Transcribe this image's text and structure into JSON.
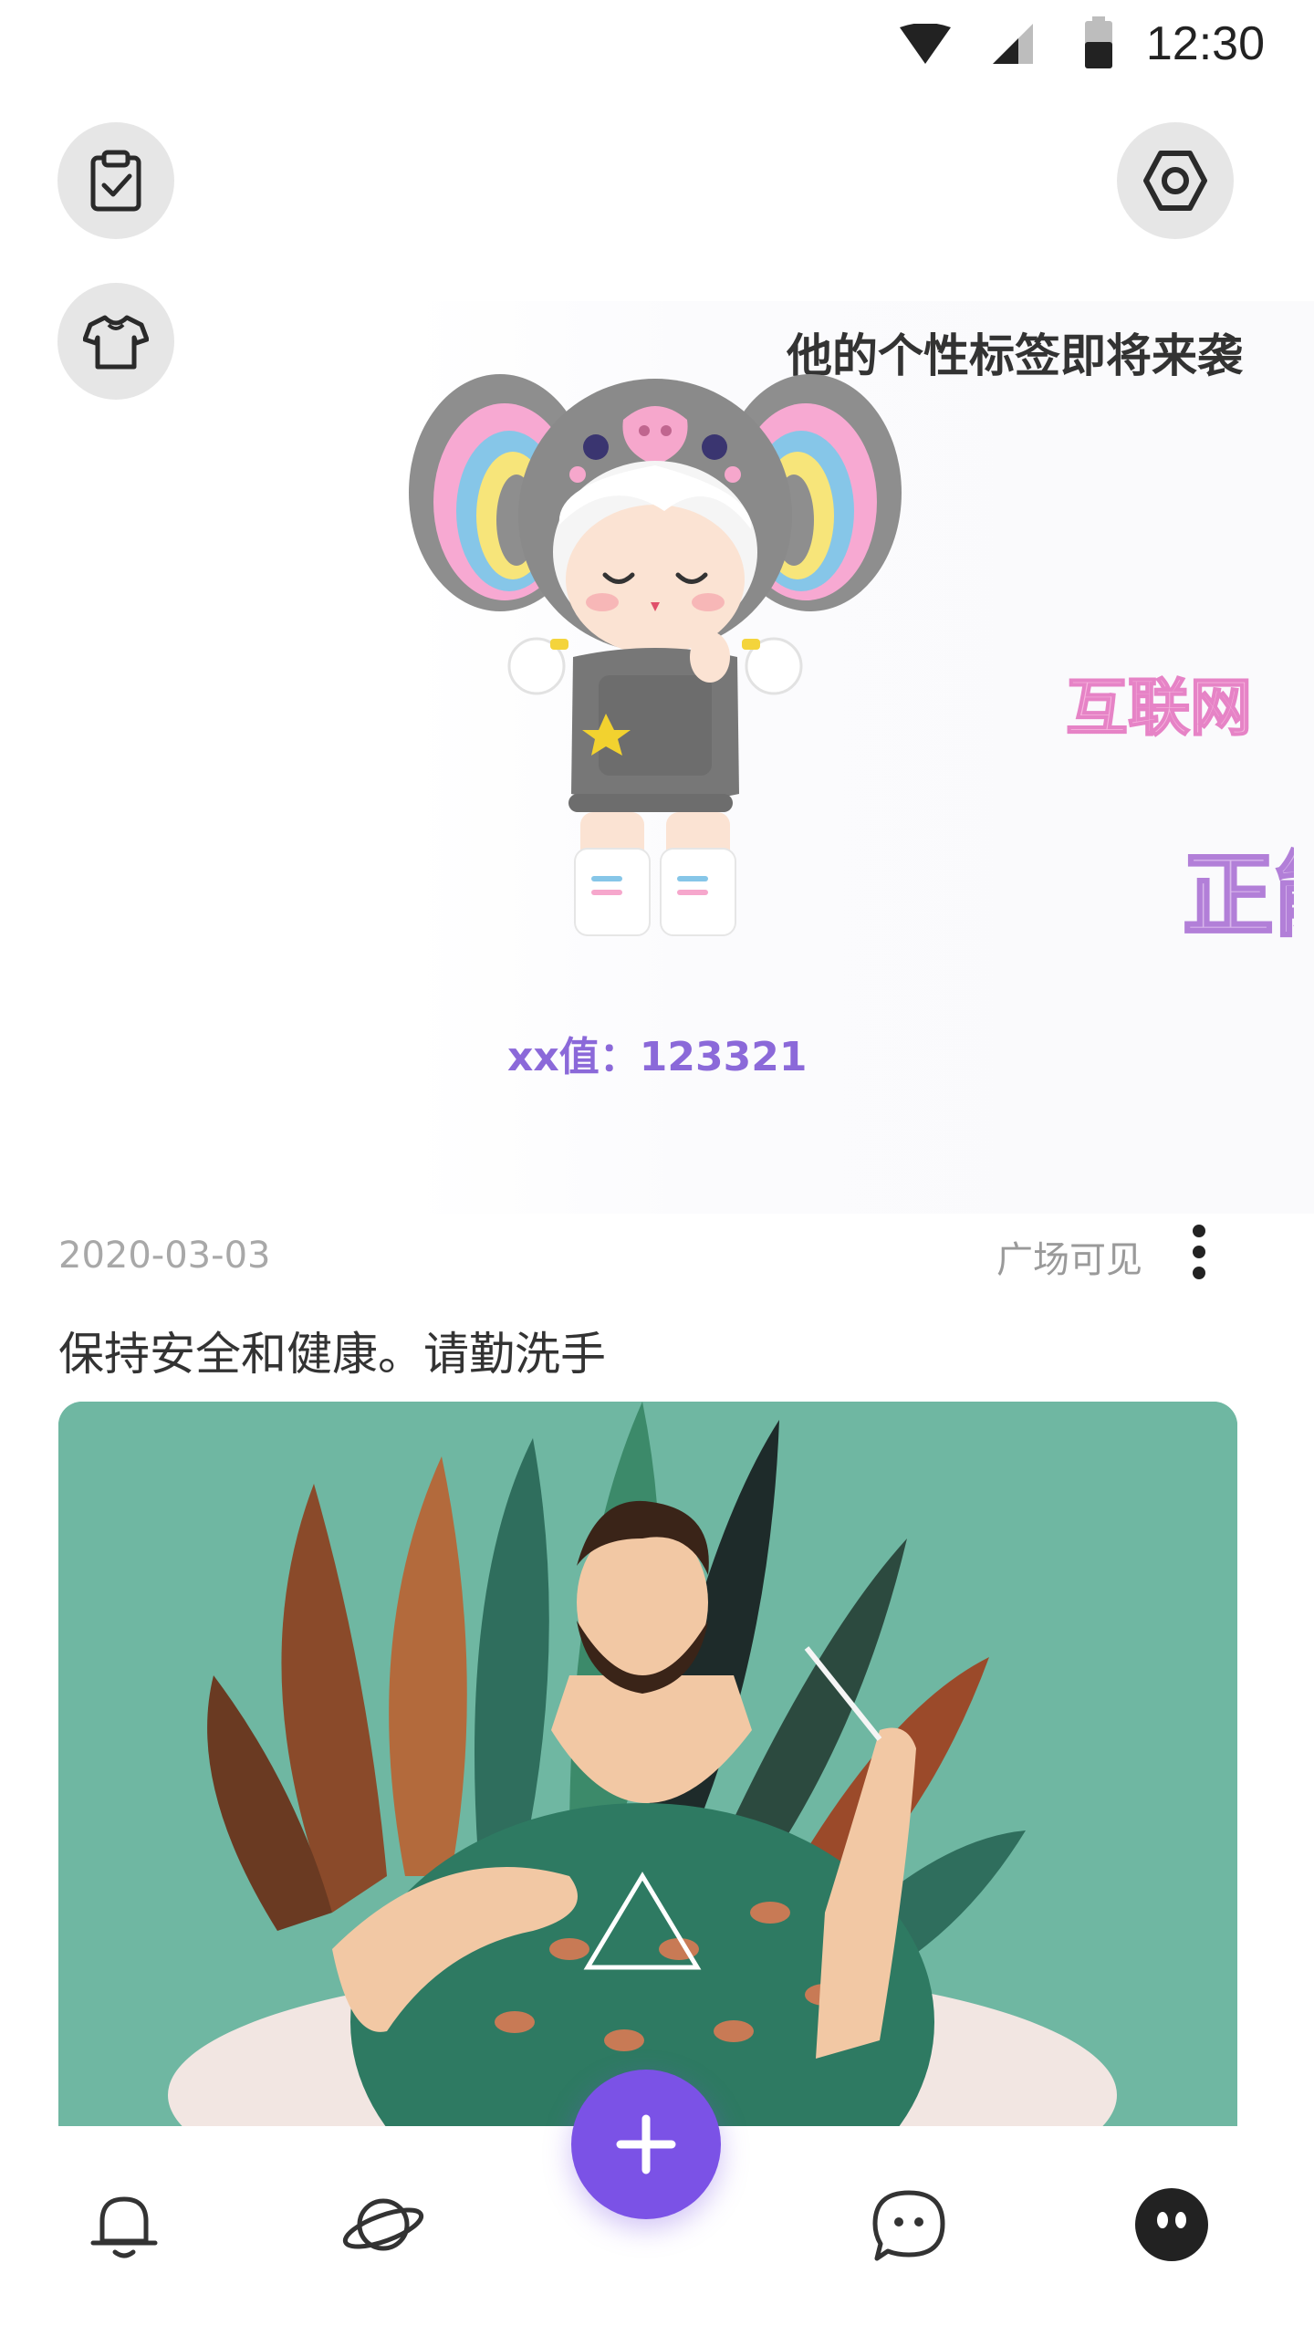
{
  "status_bar": {
    "time": "12:30"
  },
  "header": {
    "tasks_icon": "clipboard-check-icon",
    "outfit_icon": "tshirt-icon",
    "settings_icon": "hexagon-settings-icon"
  },
  "profile": {
    "tag_line": "他的个性标签即将来袭",
    "floating_tags": [
      "互联网",
      "正能"
    ],
    "score_label": "xx值：",
    "score_value": "123321",
    "avatar": "elephant-hood-doll-figure"
  },
  "post": {
    "date": "2020-03-03",
    "visibility": "广场可见",
    "text": "保持安全和健康。请勤洗手",
    "image": "bearded-man-with-leaves-illustration"
  },
  "tab_bar": {
    "items": [
      {
        "icon": "bell-icon"
      },
      {
        "icon": "planet-icon"
      },
      {
        "icon": "plus-icon"
      },
      {
        "icon": "chat-bubble-icon"
      },
      {
        "icon": "profile-face-icon"
      }
    ]
  },
  "colors": {
    "accent": "#7b52e6",
    "score_text": "#8b69d9",
    "tag_pink": "#f7b4de",
    "tag_purple": "#d8b6ec",
    "illustration_bg": "#6fb7a2"
  }
}
